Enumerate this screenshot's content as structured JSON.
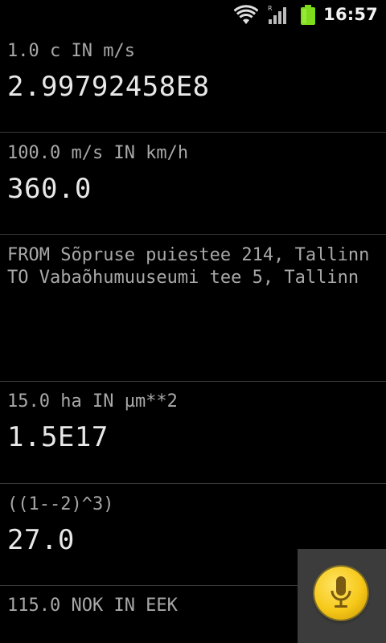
{
  "status_bar": {
    "time": "16:57",
    "icons": [
      "wifi-icon",
      "signal-icon",
      "battery-icon"
    ],
    "roaming_indicator": "R",
    "battery_color": "#7fdc1c"
  },
  "results": [
    {
      "query": "1.0 c IN m/s",
      "result": "2.99792458E8"
    },
    {
      "query": "100.0 m/s IN km/h",
      "result": "360.0"
    },
    {
      "query": "FROM Sõpruse puiestee 214, Tallinn TO Vabaõhumuuseumi tee 5, Tallinn",
      "result": ""
    },
    {
      "query": "15.0 ha IN µm**2",
      "result": "1.5E17"
    },
    {
      "query": "((1--2)^3)",
      "result": "27.0"
    },
    {
      "query": "115.0 NOK IN EEK",
      "result": ""
    }
  ],
  "mic": {
    "icon": "microphone-icon",
    "button_color": "#f6c819"
  }
}
